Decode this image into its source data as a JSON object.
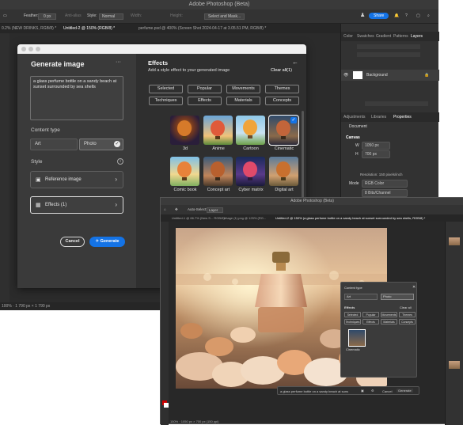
{
  "back_window": {
    "title": "Adobe Photoshop (Beta)",
    "options": {
      "feather_label": "Feather:",
      "feather_value": "0 px",
      "anti_alias": "Anti-alias",
      "style_label": "Style:",
      "style_value": "Normal",
      "width_label": "Width:",
      "height_label": "Height:",
      "select_mask": "Select and Mask...",
      "share": "Share"
    },
    "tabs": [
      "0.2% (NEW DRINKS, RGB/8) *",
      "Untitled-2 @ 150% (RGB/8) *",
      "perfume.psd @ 400% (Screen Shot 2024-04-17 at 3.05.51 PM, RGB/8) *"
    ],
    "status": "100% · 1 790 px × 1 790 px",
    "panels": {
      "top_tabs": [
        "Color",
        "Swatches",
        "Gradient",
        "Patterns",
        "Layers"
      ],
      "layer_name": "Background",
      "mid_tabs": [
        "Adjustments",
        "Libraries",
        "Properties"
      ],
      "doc_label": "Document",
      "canvas_label": "Canvas",
      "w_label": "W",
      "w_value": "1050 px",
      "h_label": "H",
      "h_value": "700 px",
      "resolution": "Resolution: 150 pixels/inch",
      "mode_label": "Mode",
      "mode_value": "RGB Color",
      "bit_value": "8 Bits/Channel"
    }
  },
  "dialog": {
    "title": "Generate image",
    "more": "···",
    "prompt": "a glass perfume bottle on a sandy beach at sunset surrounded by sea shells",
    "content_type_label": "Content type",
    "content_type_options": [
      {
        "label": "Art",
        "selected": false
      },
      {
        "label": "Photo",
        "selected": true
      }
    ],
    "style_label": "Style",
    "reference_image": "Reference image",
    "effects_button": "Effects (1)",
    "cancel": "Cancel",
    "generate": "Generate",
    "effects_title": "Effects",
    "effects_subtitle": "Add a style effect to your generated image",
    "clear_all": "Clear all(1)",
    "categories": [
      "Selected",
      "Popular",
      "Movements",
      "Themes",
      "Techniques",
      "Effects",
      "Materials",
      "Concepts"
    ],
    "effects": [
      {
        "label": "3d",
        "selected": false
      },
      {
        "label": "Anime",
        "selected": false
      },
      {
        "label": "Cartoon",
        "selected": false
      },
      {
        "label": "Cinematic",
        "selected": true
      },
      {
        "label": "Comic book",
        "selected": false
      },
      {
        "label": "Concept art",
        "selected": false
      },
      {
        "label": "Cyber matrix",
        "selected": false
      },
      {
        "label": "Digital art",
        "selected": false
      }
    ]
  },
  "front_window": {
    "title": "Adobe Photoshop (Beta)",
    "options": {
      "auto_select": "Auto-Select:",
      "layer": "Layer"
    },
    "tabs": [
      "Untitled-1 @ 66.7% (New S... RGB/8) *",
      "Image (1).png @ 125% (RG...",
      "Untitled-2 @ 150% (a glass perfume bottle on a sandy beach at sunset surrounded by sea shells, RGB/8) *"
    ],
    "mini_panel": {
      "content_type": "Content type",
      "art": "Art",
      "photo": "Photo",
      "effects": "Effects",
      "clear_all": "Clear all",
      "chips": [
        "Selected",
        "Popular",
        "Movements",
        "Themes",
        "Techniques",
        "Effects",
        "Materials",
        "Concepts"
      ],
      "selected_effect": "Cinematic"
    },
    "context_prompt": "a glass perfume bottle on a sandy beach at suns",
    "context_cancel": "Cancel",
    "context_generate": "Generate",
    "status": "150% · 1050 px × 700 px (150 ppi)"
  }
}
